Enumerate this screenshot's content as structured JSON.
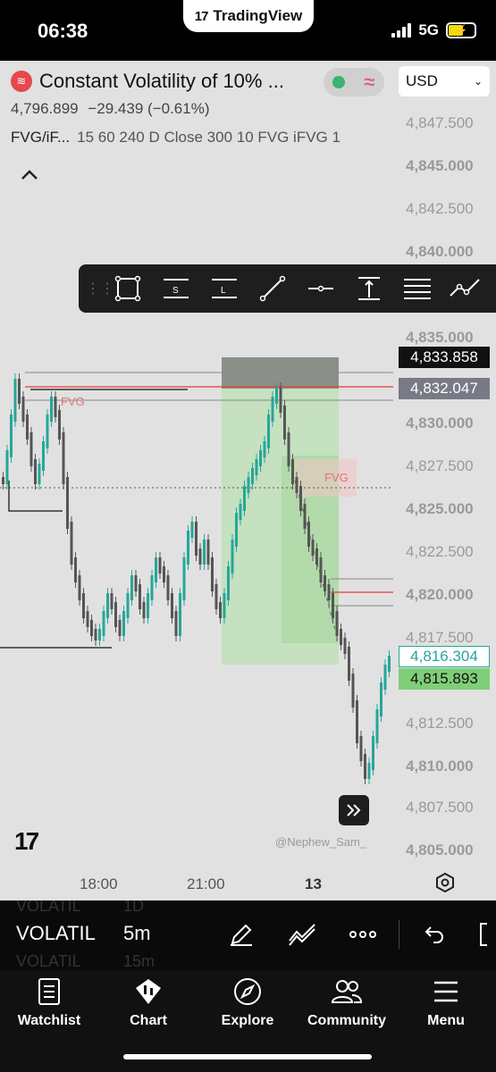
{
  "status": {
    "time": "06:38",
    "app_badge": "TradingView",
    "network": "5G"
  },
  "header": {
    "symbol_name": "Constant Volatility of 10% ...",
    "last_price": "4,796.899",
    "change": "−29.439 (−0.61%)",
    "indicator_name": "FVG/iF...",
    "indicator_args": "15 60 240 D Close 300 10 FVG iFVG 1",
    "currency": "USD"
  },
  "chart": {
    "price_axis": [
      "4,847.500",
      "4,845.000",
      "4,842.500",
      "4,840.000",
      "4,835.000",
      "4,830.000",
      "4,827.500",
      "4,825.000",
      "4,822.500",
      "4,820.000",
      "4,817.500",
      "4,812.500",
      "4,810.000",
      "4,807.500",
      "4,805.000"
    ],
    "badges": {
      "line_a": "4,833.858",
      "line_b": "4,832.047",
      "current": "4,816.304",
      "bid": "4,815.893"
    },
    "fvg_labels": [
      "FVG",
      "FVG"
    ],
    "time_axis": [
      "18:00",
      "21:00",
      "13"
    ],
    "watermark": "@Nephew_Sam_",
    "logo_text": "17",
    "colors": {
      "up": "#26a69a",
      "down": "#555555",
      "long_zone": "#bfe0b9",
      "fvg": "#e53935"
    }
  },
  "drawing_tools": [
    "rectangle-icon",
    "support-lines-icon",
    "level-lines-icon",
    "trendline-icon",
    "horizontal-line-icon",
    "price-range-icon",
    "parallel-lines-icon",
    "path-icon"
  ],
  "bottom_toolbar": {
    "symbol": "VOLATIL",
    "interval": "5m",
    "ghost_above": [
      "VOLATIL",
      "1D"
    ],
    "ghost_below": [
      "VOLATIL",
      "15m"
    ]
  },
  "tabs": [
    {
      "icon": "watchlist-icon",
      "label": "Watchlist"
    },
    {
      "icon": "chart-icon",
      "label": "Chart"
    },
    {
      "icon": "explore-icon",
      "label": "Explore"
    },
    {
      "icon": "community-icon",
      "label": "Community"
    },
    {
      "icon": "menu-icon",
      "label": "Menu"
    }
  ]
}
